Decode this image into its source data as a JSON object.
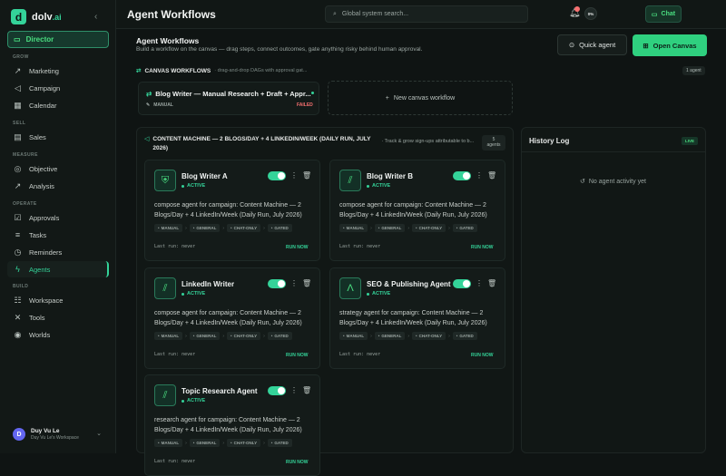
{
  "app": {
    "logo_letter": "d",
    "logo_name": "dolv",
    "logo_tld": ".ai",
    "collapse_icon": "chevron-left-icon"
  },
  "sidebar": {
    "director": "Director",
    "sections": {
      "grow": "GROW",
      "sell": "SELL",
      "measure": "MEASURE",
      "operate": "OPERATE",
      "build": "BUILD"
    },
    "items": {
      "marketing": "Marketing",
      "campaign": "Campaign",
      "calendar": "Calendar",
      "sales": "Sales",
      "objective": "Objective",
      "analysis": "Analysis",
      "approvals": "Approvals",
      "tasks": "Tasks",
      "reminders": "Reminders",
      "agents": "Agents",
      "workspace": "Workspace",
      "tools": "Tools",
      "worlds": "Worlds"
    },
    "user": {
      "initial": "D",
      "name": "Duy Vu Le",
      "workspace": "Duy Vu Le's Workspace"
    }
  },
  "topbar": {
    "title": "Agent Workflows",
    "search_placeholder": "Global system search...",
    "chat": "Chat",
    "progress": "0%"
  },
  "header": {
    "title": "Agent Workflows",
    "subtitle": "Build a workflow on the canvas — drag steps, connect outcomes, gate anything risky behind human approval.",
    "quick_agent": "Quick agent",
    "open_canvas": "Open Canvas"
  },
  "canvas_workflows": {
    "label": "CANVAS WORKFLOWS",
    "sublabel": "· drag-and-drop DAGs with approval gat...",
    "count": "1 agent",
    "workflow": {
      "title": "Blog Writer — Manual Research + Draft + Appr...",
      "trigger": "MANUAL",
      "status": "FAILED"
    },
    "new_label": "New canvas workflow"
  },
  "content_machine": {
    "title": "CONTENT MACHINE — 2 BLOGS/DAY + 4 LINKEDIN/WEEK (DAILY RUN, JULY 2026)",
    "sub": "· Track & grow sign-ups attributable to b...",
    "badge_num": "5",
    "badge_label": "agents",
    "agents": [
      {
        "name": "Blog Writer A",
        "status": "ACTIVE",
        "icon": "shield-icon",
        "desc": "compose agent for campaign: Content Machine — 2 Blogs/Day + 4 LinkedIn/Week (Daily Run, July 2026)",
        "tags": [
          "MANUAL",
          "GENERAL",
          "CHAT-ONLY",
          "GATED"
        ],
        "last_run": "Last run: never",
        "run": "RUN NOW"
      },
      {
        "name": "Blog Writer B",
        "status": "ACTIVE",
        "icon": "chart-icon",
        "desc": "compose agent for campaign: Content Machine — 2 Blogs/Day + 4 LinkedIn/Week (Daily Run, July 2026)",
        "tags": [
          "MANUAL",
          "GENERAL",
          "CHAT-ONLY",
          "GATED"
        ],
        "last_run": "Last run: never",
        "run": "RUN NOW"
      },
      {
        "name": "LinkedIn Writer",
        "status": "ACTIVE",
        "icon": "chart-icon",
        "desc": "compose agent for campaign: Content Machine — 2 Blogs/Day + 4 LinkedIn/Week (Daily Run, July 2026)",
        "tags": [
          "MANUAL",
          "GENERAL",
          "CHAT-ONLY",
          "GATED"
        ],
        "last_run": "Last run: never",
        "run": "RUN NOW"
      },
      {
        "name": "SEO & Publishing Agent",
        "status": "ACTIVE",
        "icon": "compass-icon",
        "desc": "strategy agent for campaign: Content Machine — 2 Blogs/Day + 4 LinkedIn/Week (Daily Run, July 2026)",
        "tags": [
          "MANUAL",
          "GENERAL",
          "CHAT-ONLY",
          "GATED"
        ],
        "last_run": "Last run: never",
        "run": "RUN NOW"
      },
      {
        "name": "Topic Research Agent",
        "status": "ACTIVE",
        "icon": "chart-icon",
        "desc": "research agent for campaign: Content Machine — 2 Blogs/Day + 4 LinkedIn/Week (Daily Run, July 2026)",
        "tags": [
          "MANUAL",
          "GENERAL",
          "CHAT-ONLY",
          "GATED"
        ],
        "last_run": "Last run: never",
        "run": "RUN NOW"
      }
    ]
  },
  "history": {
    "title": "History Log",
    "live": "LIVE",
    "empty": "No agent activity yet"
  },
  "colors": {
    "accent": "#34d399",
    "background": "#0f1413",
    "failed": "#f87171"
  }
}
